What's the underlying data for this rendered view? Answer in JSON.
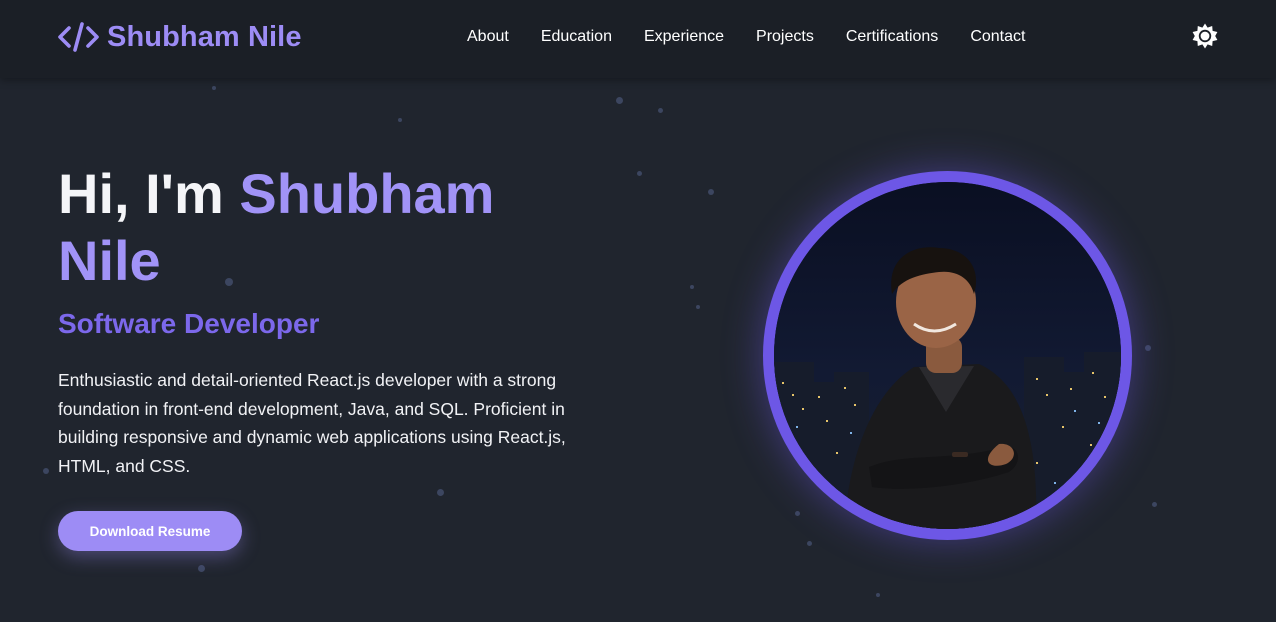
{
  "brand": {
    "icon": "code-brackets-icon",
    "name": "Shubham Nile"
  },
  "nav": {
    "items": [
      {
        "label": "About"
      },
      {
        "label": "Education"
      },
      {
        "label": "Experience"
      },
      {
        "label": "Projects"
      },
      {
        "label": "Certifications"
      },
      {
        "label": "Contact"
      }
    ]
  },
  "theme_toggle": {
    "icon": "sun-icon"
  },
  "hero": {
    "greeting": "Hi, I'm ",
    "name": "Shubham Nile",
    "role": "Software Developer",
    "description": "Enthusiastic and detail-oriented React.js developer with a strong foundation in front-end development, Java, and SQL. Proficient in building responsive and dynamic web applications using React.js, HTML, and CSS.",
    "button_label": "Download Resume",
    "portrait": "profile-photo"
  },
  "colors": {
    "background": "#20252e",
    "header": "#1b1f26",
    "accent": "#9d8cf5",
    "accent_dark": "#6d57e6"
  }
}
